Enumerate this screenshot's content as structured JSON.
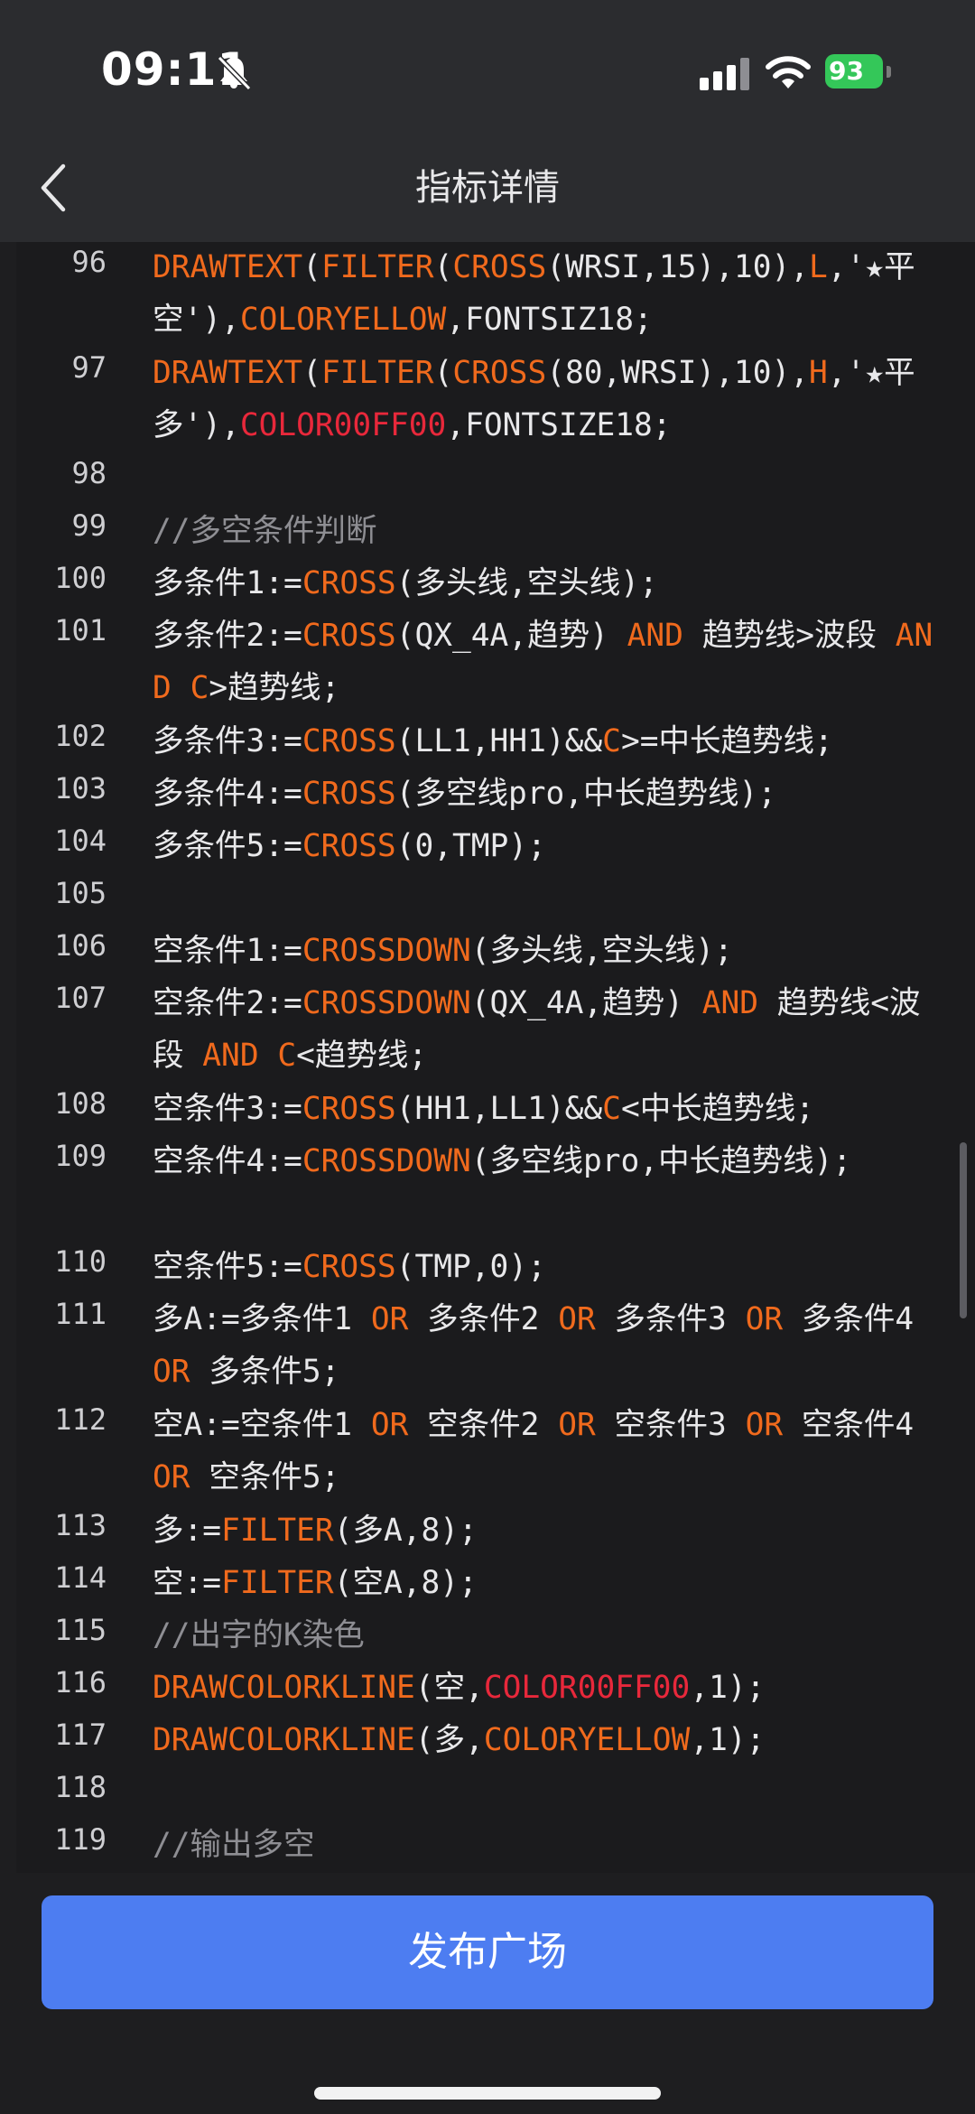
{
  "status_bar": {
    "time": "09:11",
    "battery": "93"
  },
  "nav": {
    "title": "指标详情"
  },
  "code_lines": [
    {
      "num": "96",
      "tokens": [
        {
          "t": "DRAWTEXT",
          "c": "k"
        },
        {
          "t": "(",
          "c": ""
        },
        {
          "t": "FILTER",
          "c": "k"
        },
        {
          "t": "(",
          "c": ""
        },
        {
          "t": "CROSS",
          "c": "k"
        },
        {
          "t": "(WRSI,15),10),",
          "c": ""
        },
        {
          "t": "L",
          "c": "k"
        },
        {
          "t": ",'★平空'),",
          "c": ""
        },
        {
          "t": "COLORYELLOW",
          "c": "k"
        },
        {
          "t": ",FONTSIZ18;",
          "c": ""
        }
      ]
    },
    {
      "num": "97",
      "tokens": [
        {
          "t": "DRAWTEXT",
          "c": "k"
        },
        {
          "t": "(",
          "c": ""
        },
        {
          "t": "FILTER",
          "c": "k"
        },
        {
          "t": "(",
          "c": ""
        },
        {
          "t": "CROSS",
          "c": "k"
        },
        {
          "t": "(80,WRSI),10),",
          "c": ""
        },
        {
          "t": "H",
          "c": "k"
        },
        {
          "t": ",'★平多'),",
          "c": ""
        },
        {
          "t": "COLOR00FF00",
          "c": "r"
        },
        {
          "t": ",FONTSIZE18;",
          "c": ""
        }
      ]
    },
    {
      "num": "98",
      "tokens": []
    },
    {
      "num": "99",
      "tokens": [
        {
          "t": "//多空条件判断",
          "c": "c"
        }
      ]
    },
    {
      "num": "100",
      "tokens": [
        {
          "t": "多条件1:=",
          "c": ""
        },
        {
          "t": "CROSS",
          "c": "k"
        },
        {
          "t": "(多头线,空头线);",
          "c": ""
        }
      ]
    },
    {
      "num": "101",
      "tokens": [
        {
          "t": "多条件2:=",
          "c": ""
        },
        {
          "t": "CROSS",
          "c": "k"
        },
        {
          "t": "(QX_4A,趋势) ",
          "c": ""
        },
        {
          "t": "AND",
          "c": "k"
        },
        {
          "t": " 趋势线>波段 ",
          "c": ""
        },
        {
          "t": "AND",
          "c": "k"
        },
        {
          "t": " ",
          "c": ""
        },
        {
          "t": "C",
          "c": "k"
        },
        {
          "t": ">趋势线;",
          "c": ""
        }
      ]
    },
    {
      "num": "102",
      "tokens": [
        {
          "t": "多条件3:=",
          "c": ""
        },
        {
          "t": "CROSS",
          "c": "k"
        },
        {
          "t": "(LL1,HH1)&&",
          "c": ""
        },
        {
          "t": "C",
          "c": "k"
        },
        {
          "t": ">=中长趋势线;",
          "c": ""
        }
      ]
    },
    {
      "num": "103",
      "tokens": [
        {
          "t": "多条件4:=",
          "c": ""
        },
        {
          "t": "CROSS",
          "c": "k"
        },
        {
          "t": "(多空线pro,中长趋势线);",
          "c": ""
        }
      ]
    },
    {
      "num": "104",
      "tokens": [
        {
          "t": "多条件5:=",
          "c": ""
        },
        {
          "t": "CROSS",
          "c": "k"
        },
        {
          "t": "(0,TMP);",
          "c": ""
        }
      ]
    },
    {
      "num": "105",
      "tokens": []
    },
    {
      "num": "106",
      "tokens": [
        {
          "t": "空条件1:=",
          "c": ""
        },
        {
          "t": "CROSSDOWN",
          "c": "k"
        },
        {
          "t": "(多头线,空头线);",
          "c": ""
        }
      ]
    },
    {
      "num": "107",
      "tokens": [
        {
          "t": "空条件2:=",
          "c": ""
        },
        {
          "t": "CROSSDOWN",
          "c": "k"
        },
        {
          "t": "(QX_4A,趋势) ",
          "c": ""
        },
        {
          "t": "AND",
          "c": "k"
        },
        {
          "t": " 趋势线<波段 ",
          "c": ""
        },
        {
          "t": "AND",
          "c": "k"
        },
        {
          "t": " ",
          "c": ""
        },
        {
          "t": "C",
          "c": "k"
        },
        {
          "t": "<趋势线;",
          "c": ""
        }
      ]
    },
    {
      "num": "108",
      "tokens": [
        {
          "t": "空条件3:=",
          "c": ""
        },
        {
          "t": "CROSS",
          "c": "k"
        },
        {
          "t": "(HH1,LL1)&&",
          "c": ""
        },
        {
          "t": "C",
          "c": "k"
        },
        {
          "t": "<中长趋势线;",
          "c": ""
        }
      ]
    },
    {
      "num": "109",
      "tokens": [
        {
          "t": "空条件4:=",
          "c": ""
        },
        {
          "t": "CROSSDOWN",
          "c": "k"
        },
        {
          "t": "(多空线pro,中长趋势线);",
          "c": ""
        }
      ]
    },
    {
      "num": "110",
      "tokens": [
        {
          "t": "空条件5:=",
          "c": ""
        },
        {
          "t": "CROSS",
          "c": "k"
        },
        {
          "t": "(TMP,0);",
          "c": ""
        }
      ]
    },
    {
      "num": "111",
      "tokens": [
        {
          "t": "多A:=多条件1 ",
          "c": ""
        },
        {
          "t": "OR",
          "c": "k"
        },
        {
          "t": " 多条件2 ",
          "c": ""
        },
        {
          "t": "OR",
          "c": "k"
        },
        {
          "t": " 多条件3 ",
          "c": ""
        },
        {
          "t": "OR",
          "c": "k"
        },
        {
          "t": " 多条件4 ",
          "c": ""
        },
        {
          "t": "OR",
          "c": "k"
        },
        {
          "t": " 多条件5;",
          "c": ""
        }
      ]
    },
    {
      "num": "112",
      "tokens": [
        {
          "t": "空A:=空条件1 ",
          "c": ""
        },
        {
          "t": "OR",
          "c": "k"
        },
        {
          "t": " 空条件2 ",
          "c": ""
        },
        {
          "t": "OR",
          "c": "k"
        },
        {
          "t": " 空条件3 ",
          "c": ""
        },
        {
          "t": "OR",
          "c": "k"
        },
        {
          "t": " 空条件4 ",
          "c": ""
        },
        {
          "t": "OR",
          "c": "k"
        },
        {
          "t": " 空条件5;",
          "c": ""
        }
      ]
    },
    {
      "num": "113",
      "tokens": [
        {
          "t": "多:=",
          "c": ""
        },
        {
          "t": "FILTER",
          "c": "k"
        },
        {
          "t": "(多A,8);",
          "c": ""
        }
      ]
    },
    {
      "num": "114",
      "tokens": [
        {
          "t": "空:=",
          "c": ""
        },
        {
          "t": "FILTER",
          "c": "k"
        },
        {
          "t": "(空A,8);",
          "c": ""
        }
      ]
    },
    {
      "num": "115",
      "tokens": [
        {
          "t": "//出字的K染色",
          "c": "c"
        }
      ]
    },
    {
      "num": "116",
      "tokens": [
        {
          "t": "DRAWCOLORKLINE",
          "c": "k"
        },
        {
          "t": "(空,",
          "c": ""
        },
        {
          "t": "COLOR00FF00",
          "c": "r"
        },
        {
          "t": ",1);",
          "c": ""
        }
      ]
    },
    {
      "num": "117",
      "tokens": [
        {
          "t": "DRAWCOLORKLINE",
          "c": "k"
        },
        {
          "t": "(多,",
          "c": ""
        },
        {
          "t": "COLORYELLOW",
          "c": "k"
        },
        {
          "t": ",1);",
          "c": ""
        }
      ]
    },
    {
      "num": "118",
      "tokens": []
    },
    {
      "num": "119",
      "tokens": [
        {
          "t": "//输出多空",
          "c": "c"
        }
      ]
    }
  ],
  "publish_button": {
    "label": "发布广场"
  },
  "colors": {
    "keyword": "#f06a1d",
    "color_const": "#e8283b",
    "comment": "#8e8e93",
    "button": "#4d7df1"
  }
}
